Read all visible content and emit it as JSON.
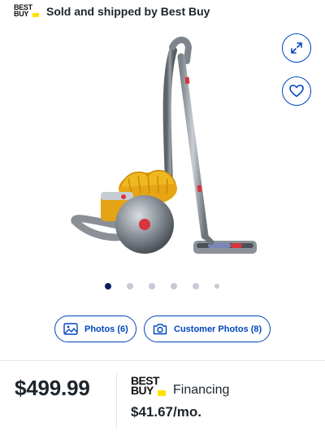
{
  "header": {
    "logo_line1": "BEST",
    "logo_line2": "BUY",
    "seller_text": "Sold and shipped by Best Buy"
  },
  "icons": {
    "expand": "expand-arrows-icon",
    "wishlist": "heart-icon",
    "photos": "image-icon",
    "customer_photos": "camera-icon"
  },
  "carousel": {
    "total": 6,
    "active_index": 0
  },
  "gallery_buttons": {
    "photos_label": "Photos (6)",
    "customer_photos_label": "Customer Photos (8)"
  },
  "pricing": {
    "price": "$499.99",
    "financing_logo_line1": "BEST",
    "financing_logo_line2": "BUY",
    "financing_label": "Financing",
    "monthly": "$41.67/mo."
  },
  "colors": {
    "accent": "#0046be",
    "logo_tag": "#ffe000",
    "active_dot": "#0a1f63",
    "inactive_dot": "#c5cbd5",
    "text": "#1d252c"
  }
}
